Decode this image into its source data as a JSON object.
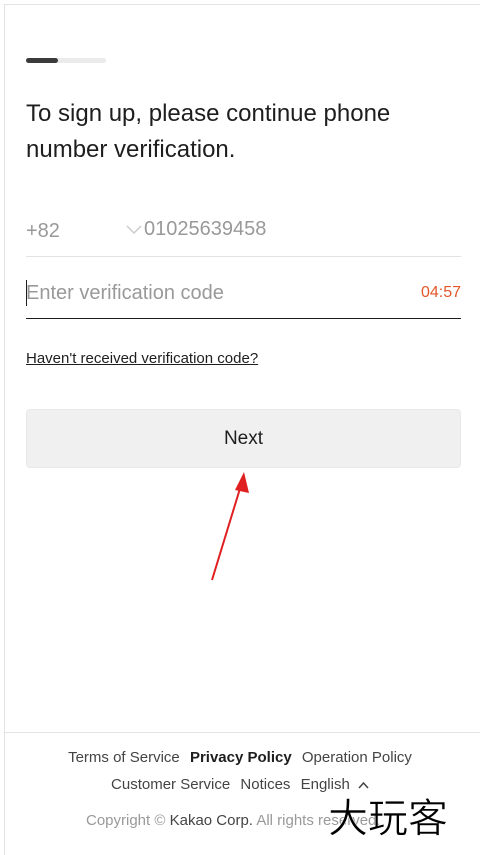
{
  "progress": {
    "fraction": 0.4
  },
  "heading": "To sign up, please continue phone number verification.",
  "phone": {
    "country_code": "+82",
    "number": "01025639458"
  },
  "verification": {
    "placeholder": "Enter verification code",
    "value": "",
    "timer": "04:57"
  },
  "resend_link": "Haven't received verification code?",
  "next_button": "Next",
  "footer": {
    "links_row1": [
      "Terms of Service",
      "Privacy Policy",
      "Operation Policy"
    ],
    "links_row2": [
      "Customer Service",
      "Notices"
    ],
    "language": "English",
    "copyright_prefix": "Copyright ©",
    "copyright_corp": "Kakao Corp.",
    "copyright_suffix": "All rights reserved."
  },
  "watermark": "大玩客",
  "colors": {
    "timer": "#e1572b",
    "annotation_arrow": "#e02020",
    "button_bg": "#f0f0f0"
  },
  "icons": [
    "chevron-down-icon",
    "caret-up-icon",
    "annotation-arrow-icon"
  ]
}
